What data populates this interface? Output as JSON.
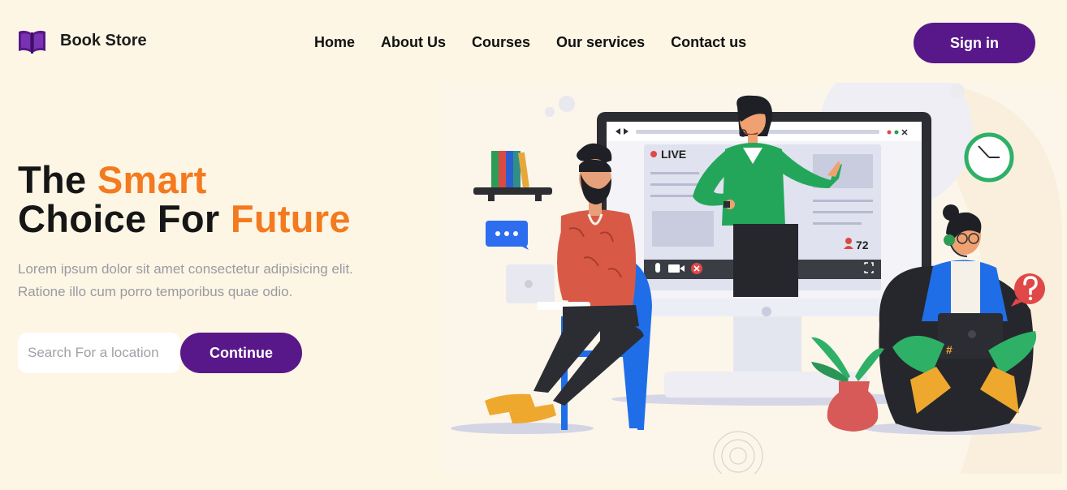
{
  "brand": {
    "name": "Book Store",
    "icon": "book-icon"
  },
  "nav": {
    "items": [
      {
        "label": "Home"
      },
      {
        "label": "About Us"
      },
      {
        "label": "Courses"
      },
      {
        "label": "Our services"
      },
      {
        "label": "Contact us"
      }
    ]
  },
  "header": {
    "signin_label": "Sign in"
  },
  "hero": {
    "title_line1_prefix": "The ",
    "title_line1_accent": "Smart",
    "title_line2_prefix": "Choice For ",
    "title_line2_accent": "Future",
    "description": "Lorem ipsum dolor sit amet consectetur adipisicing elit. Ratione illo cum porro temporibus quae odio.",
    "search_placeholder": "Search For a location",
    "search_value": "",
    "continue_label": "Continue"
  },
  "illustration": {
    "live_label": "LIVE",
    "viewer_count": "72",
    "chat_icon": "chat-bubble-icon",
    "help_icon": "question-mark-icon",
    "clock_icon": "clock-icon"
  },
  "colors": {
    "background": "#fdf6e4",
    "primary": "#58188a",
    "accent": "#f47a1f",
    "muted_text": "#9a9aa3"
  }
}
